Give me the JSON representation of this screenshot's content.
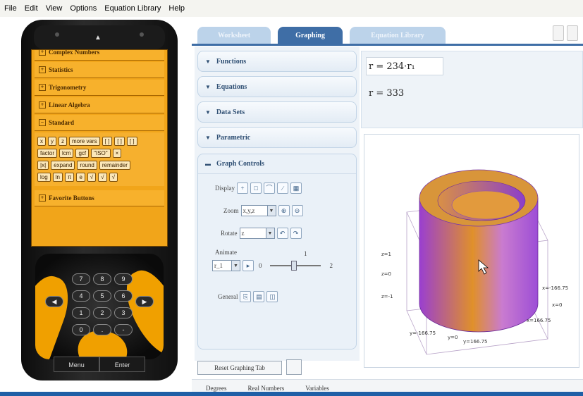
{
  "menu": [
    "File",
    "Edit",
    "View",
    "Options",
    "Equation Library",
    "Help"
  ],
  "tabs": [
    {
      "label": "Worksheet",
      "active": false
    },
    {
      "label": "Graphing",
      "active": true
    },
    {
      "label": "Equation Library",
      "active": false
    }
  ],
  "phone": {
    "sections": [
      "Complex Numbers",
      "Statistics",
      "Trigonometry",
      "Linear Algebra",
      "Standard"
    ],
    "keys": [
      [
        "x",
        "y",
        "z",
        "more vars",
        "[ ]",
        "[ ]",
        "[ ]"
      ],
      [
        "factor",
        "lcm",
        "gcf",
        "\"ISO\"",
        "×"
      ],
      [
        "|x|",
        "expand",
        "round",
        "remainder"
      ],
      [
        "log",
        "ln",
        "π",
        "e",
        "√",
        "√",
        "√"
      ]
    ],
    "favorites": "Favorite Buttons",
    "softkeys": [
      "Menu",
      "Enter"
    ],
    "keypad": [
      "7",
      "8",
      "9",
      "4",
      "5",
      "6",
      "1",
      "2",
      "3",
      "0",
      ".",
      "-"
    ]
  },
  "panels": {
    "functions": "Functions",
    "equations": "Equations",
    "data_sets": "Data Sets",
    "parametric": "Parametric",
    "graph_controls": "Graph Controls"
  },
  "controls": {
    "display_label": "Display",
    "zoom_label": "Zoom",
    "zoom_value": "x,y,z",
    "rotate_label": "Rotate",
    "rotate_value": "z",
    "animate_label": "Animate",
    "animate_var": "r_1",
    "animate_min": "0",
    "animate_mid": "1",
    "animate_max": "2",
    "general_label": "General"
  },
  "reset_button": "Reset Graphing Tab",
  "equations": {
    "eq1": "r = 234·r₁",
    "eq2": "r = 333"
  },
  "plot": {
    "labels": {
      "z_top": "z=1",
      "z_mid": "z=0",
      "z_bot": "z=-1",
      "x_neg": "x=-166.75",
      "x_zero": "x=0",
      "x_pos": "x=166.75",
      "y_neg": "y=-166.75",
      "y_zero": "y=0",
      "y_pos": "y=166.75"
    },
    "colors": {
      "outer": "#d9872a",
      "inner": "#8a3fc9",
      "top": "#e0a070"
    }
  },
  "status": [
    "Degrees",
    "Real Numbers",
    "Variables"
  ]
}
